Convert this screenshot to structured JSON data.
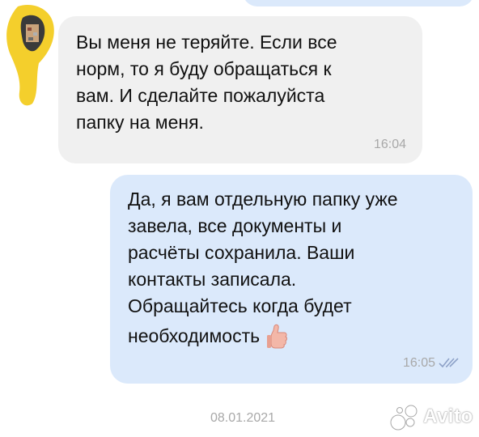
{
  "messages": [
    {
      "direction": "incoming",
      "text": "Вы меня не теряйте. Если все\nнорм, то я буду обращаться к\nвам. И сделайте пожалуйста\nпапку на меня.",
      "time": "16:04"
    },
    {
      "direction": "outgoing",
      "text": "Да, я вам отдельную папку уже\nзавела, все документы и\nрасчёты сохранила. Ваши\nконтакты записала.\nОбращайтесь когда будет",
      "last_line": "необходимость",
      "emoji": "thumbs-up-icon",
      "time": "16:05",
      "status_icon": "double-check-icon"
    }
  ],
  "date_separator": "08.01.2021",
  "watermark": "Avito",
  "colors": {
    "incoming_bubble": "#f0f0f0",
    "outgoing_bubble": "#dbe9fb",
    "time_text": "#a8a8a8",
    "read_check": "#8ea2c8"
  }
}
